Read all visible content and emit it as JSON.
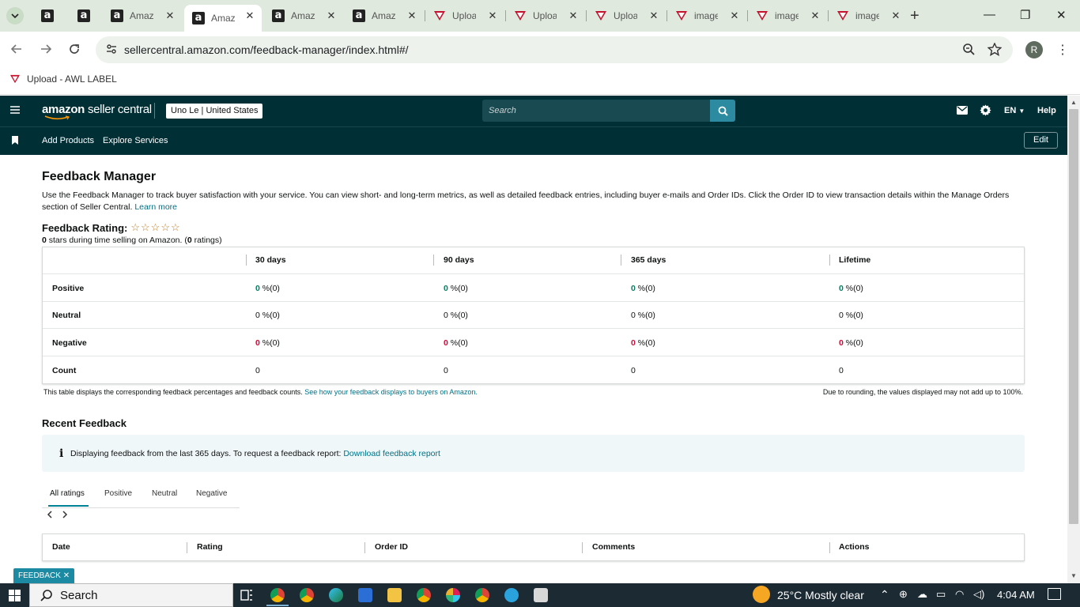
{
  "browser": {
    "tabs": [
      {
        "favicon": "amazon-a",
        "title": ""
      },
      {
        "favicon": "amazon-a",
        "title": ""
      },
      {
        "favicon": "amazon-a",
        "title": "Amaz"
      },
      {
        "favicon": "amazon-a",
        "title": "Amaz",
        "active": true
      },
      {
        "favicon": "amazon-a",
        "title": "Amaz"
      },
      {
        "favicon": "amazon-a",
        "title": "Amaz"
      },
      {
        "favicon": "awl-v",
        "title": "Uploa"
      },
      {
        "favicon": "awl-v",
        "title": "Uploa"
      },
      {
        "favicon": "awl-v",
        "title": "Uploa"
      },
      {
        "favicon": "awl-v",
        "title": "image"
      },
      {
        "favicon": "awl-v",
        "title": "image"
      },
      {
        "favicon": "awl-v",
        "title": "image"
      }
    ],
    "url": "sellercentral.amazon.com/feedback-manager/index.html#/",
    "profile_initial": "R",
    "bookmark": "Upload - AWL LABEL"
  },
  "header": {
    "logo_bold": "amazon",
    "logo_light": "seller central",
    "store": "Uno Le | United States",
    "search_placeholder": "Search",
    "language": "EN",
    "help": "Help",
    "nav": [
      "Add Products",
      "Explore Services"
    ],
    "edit": "Edit"
  },
  "page": {
    "title": "Feedback Manager",
    "intro": "Use the Feedback Manager to track buyer satisfaction with your service. You can view short- and long-term metrics, as well as detailed feedback entries, including buyer e-mails and Order IDs. Click the Order ID to view transaction details within the Manage Orders section of Seller Central.",
    "learn_more": "Learn more",
    "rating_label": "Feedback Rating:",
    "stars": "☆☆☆☆☆",
    "stars_count": "0",
    "stars_text": " stars during time selling on Amazon. (",
    "ratings_count": "0",
    "ratings_text": " ratings)"
  },
  "metrics": {
    "columns": [
      "30 days",
      "90 days",
      "365 days",
      "Lifetime"
    ],
    "rows": [
      {
        "label": "Positive",
        "values": [
          "0",
          "0",
          "0",
          "0"
        ],
        "suffix": " %(0)",
        "color": "#067d62"
      },
      {
        "label": "Neutral",
        "values": [
          "0",
          "0",
          "0",
          "0"
        ],
        "suffix": " %(0)",
        "color": "#0f1111"
      },
      {
        "label": "Negative",
        "values": [
          "0",
          "0",
          "0",
          "0"
        ],
        "suffix": " %(0)",
        "color": "#cc0c39"
      },
      {
        "label": "Count",
        "values": [
          "0",
          "0",
          "0",
          "0"
        ],
        "suffix": "",
        "color": "#0f1111"
      }
    ],
    "note_left": "This table displays the corresponding feedback percentages and feedback counts.",
    "note_link": "See how your feedback displays to buyers on Amazon.",
    "note_right": "Due to rounding, the values displayed may not add up to 100%."
  },
  "recent": {
    "title": "Recent Feedback",
    "info_text": "Displaying feedback from the last 365 days. To request a feedback report:",
    "info_link": "Download feedback report",
    "tabs": [
      "All ratings",
      "Positive",
      "Neutral",
      "Negative"
    ],
    "columns": [
      "Date",
      "Rating",
      "Order ID",
      "Comments",
      "Actions"
    ]
  },
  "feedback_tag": "FEEDBACK",
  "taskbar": {
    "search": "Search",
    "weather": "25°C  Mostly clear",
    "time": "4:04 AM"
  },
  "colors": {
    "header_bg": "#002f36",
    "link": "#007185",
    "positive": "#067d62",
    "negative": "#cc0c39",
    "accent": "#008296"
  }
}
